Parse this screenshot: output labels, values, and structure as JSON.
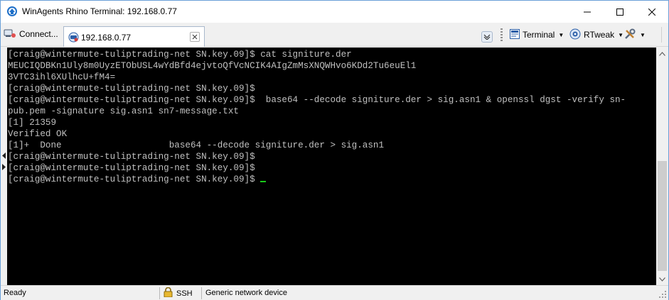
{
  "window": {
    "title": "WinAgents Rhino Terminal: 192.168.0.77"
  },
  "toolbar": {
    "connect_label": "Connect...",
    "terminal_label": "Terminal",
    "rtweak_label": "RTweak"
  },
  "tabs": [
    {
      "label": "192.168.0.77",
      "active": true
    }
  ],
  "terminal": {
    "lines": [
      "[craig@wintermute-tuliptrading-net SN.key.09]$ cat signiture.der",
      "MEUCIQDBKn1Uly8m0UyzETObUSL4wYdBfd4ejvtoQfVcNCIK4AIgZmMsXNQWHvo6KDd2Tu6euEl1",
      "3VTC3ihl6XUlhcU+fM4=",
      "[craig@wintermute-tuliptrading-net SN.key.09]$",
      "[craig@wintermute-tuliptrading-net SN.key.09]$  base64 --decode signiture.der > sig.asn1 & openssl dgst -verify sn-",
      "pub.pem -signature sig.asn1 sn7-message.txt",
      "[1] 21359",
      "Verified OK",
      "[1]+  Done                    base64 --decode signiture.der > sig.asn1",
      "[craig@wintermute-tuliptrading-net SN.key.09]$",
      "[craig@wintermute-tuliptrading-net SN.key.09]$",
      "[craig@wintermute-tuliptrading-net SN.key.09]$ "
    ],
    "text_color": "#c0c0c0",
    "background": "#000000",
    "cursor_color": "#19c819"
  },
  "statusbar": {
    "status": "Ready",
    "protocol": "SSH",
    "device": "Generic network device"
  },
  "icons": {
    "app": "rhino-terminal-icon",
    "connect": "connect-icon",
    "tab": "session-icon",
    "terminal": "terminal-icon",
    "rtweak": "rtweak-icon",
    "settings": "tools-icon",
    "ssh": "lock-icon"
  }
}
